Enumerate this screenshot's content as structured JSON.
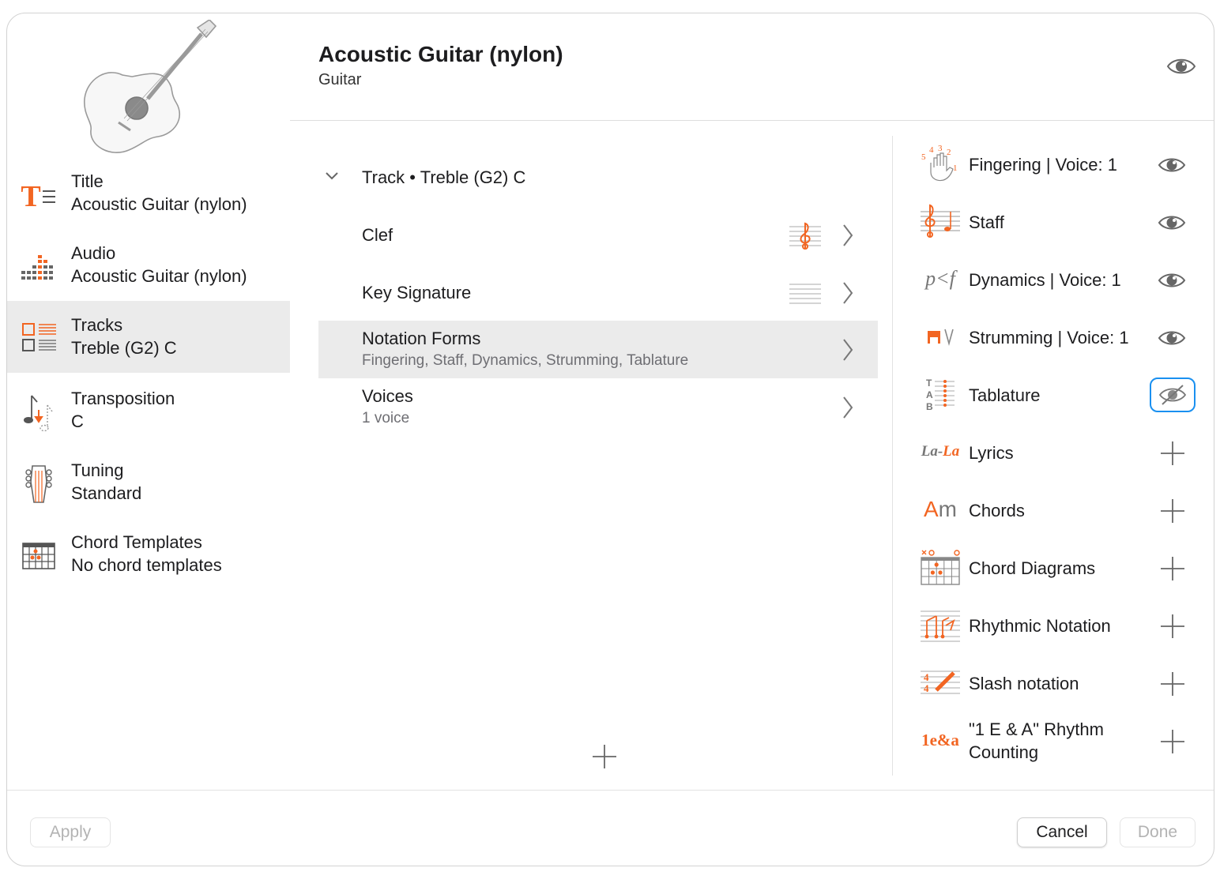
{
  "header": {
    "title": "Acoustic Guitar (nylon)",
    "subtitle": "Guitar"
  },
  "sidebar": {
    "items": [
      {
        "label": "Title",
        "value": "Acoustic Guitar (nylon)",
        "icon": "title-text-icon"
      },
      {
        "label": "Audio",
        "value": "Acoustic Guitar (nylon)",
        "icon": "audio-level-icon"
      },
      {
        "label": "Tracks",
        "value": "Treble (G2) C",
        "icon": "tracks-icon",
        "selected": true
      },
      {
        "label": "Transposition",
        "value": "C",
        "icon": "transposition-icon"
      },
      {
        "label": "Tuning",
        "value": "Standard",
        "icon": "tuning-peghead-icon"
      },
      {
        "label": "Chord Templates",
        "value": "No chord templates",
        "icon": "chord-grid-icon"
      }
    ]
  },
  "middle": {
    "track_header": "Track • Treble (G2) C",
    "rows": [
      {
        "label": "Clef",
        "icon": "treble-clef-icon"
      },
      {
        "label": "Key Signature",
        "icon": "staff-lines-icon"
      },
      {
        "label": "Notation Forms",
        "sub": "Fingering, Staff, Dynamics, Strumming, Tablature",
        "selected": true
      },
      {
        "label": "Voices",
        "sub": "1 voice"
      }
    ]
  },
  "notation_forms": [
    {
      "label": "Fingering | Voice: 1",
      "state": "visible",
      "icon": "fingering-hand-icon"
    },
    {
      "label": "Staff",
      "state": "visible",
      "icon": "staff-clef-icon"
    },
    {
      "label": "Dynamics | Voice: 1",
      "state": "visible",
      "icon": "dynamics-icon"
    },
    {
      "label": "Strumming | Voice: 1",
      "state": "visible",
      "icon": "strumming-icon"
    },
    {
      "label": "Tablature",
      "state": "hidden",
      "icon": "tablature-icon"
    },
    {
      "label": "Lyrics",
      "state": "add",
      "icon": "lyrics-icon"
    },
    {
      "label": "Chords",
      "state": "add",
      "icon": "chords-icon"
    },
    {
      "label": "Chord Diagrams",
      "state": "add",
      "icon": "chord-diagram-icon"
    },
    {
      "label": "Rhythmic Notation",
      "state": "add",
      "icon": "rhythmic-notation-icon"
    },
    {
      "label": "Slash notation",
      "state": "add",
      "icon": "slash-notation-icon"
    },
    {
      "label": "\"1 E & A\" Rhythm Counting",
      "state": "add",
      "icon": "rhythm-counting-icon"
    }
  ],
  "icon_text": {
    "title": "T",
    "dynamics": "p<f",
    "lyrics": "La-La",
    "chords": "Am",
    "counting": "1e&a",
    "tab": [
      "T",
      "A",
      "B"
    ],
    "fingering": [
      "5",
      "4",
      "3",
      "2",
      "1"
    ]
  },
  "footer": {
    "apply": "Apply",
    "cancel": "Cancel",
    "done": "Done"
  },
  "colors": {
    "accent": "#f26522",
    "focus": "#1a90f0",
    "selection": "#ebebeb"
  }
}
